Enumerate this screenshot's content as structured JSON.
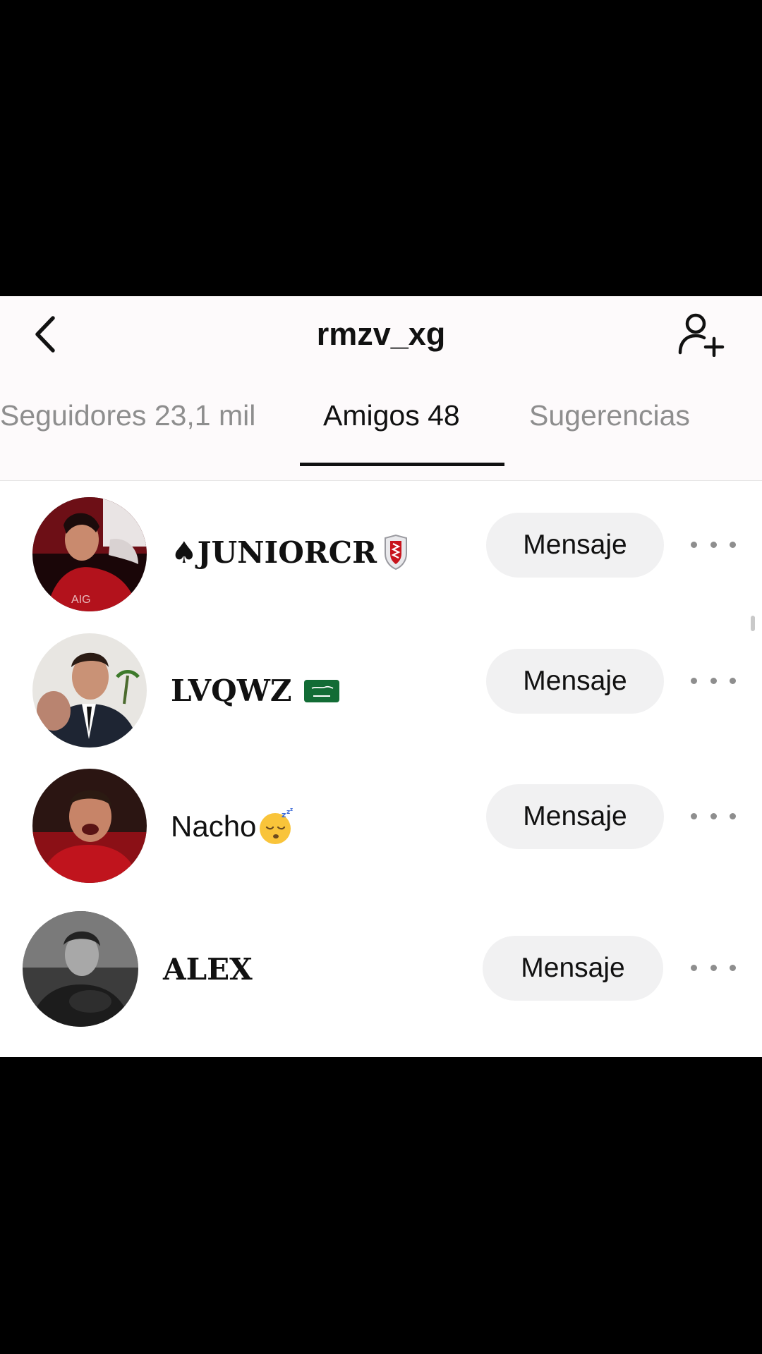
{
  "header": {
    "title": "rmzv_xg",
    "back_icon": "chevron-left-icon",
    "add_friend_icon": "add-user-icon"
  },
  "tabs": [
    {
      "label": "Seguidores 23,1 mil",
      "active": false
    },
    {
      "label": "Amigos 48",
      "active": true
    },
    {
      "label": "Sugerencias",
      "active": false
    }
  ],
  "friends": [
    {
      "name": "♠JUNIORCR",
      "name_emoji": "shield-icon",
      "button_label": "Mensaje",
      "avatar_icon": "avatar-photo"
    },
    {
      "name": "LVQWZ",
      "name_emoji": "saudi-flag-icon",
      "button_label": "Mensaje",
      "avatar_icon": "avatar-photo"
    },
    {
      "name": "Nacho",
      "name_emoji": "sleeping-face-icon",
      "button_label": "Mensaje",
      "avatar_icon": "avatar-photo"
    },
    {
      "name": "ALEX",
      "name_emoji": "",
      "button_label": "Mensaje",
      "avatar_icon": "avatar-photo"
    }
  ],
  "colors": {
    "accent": "#111111",
    "button_bg": "#f1f1f2",
    "muted_text": "#8e8e8e"
  }
}
